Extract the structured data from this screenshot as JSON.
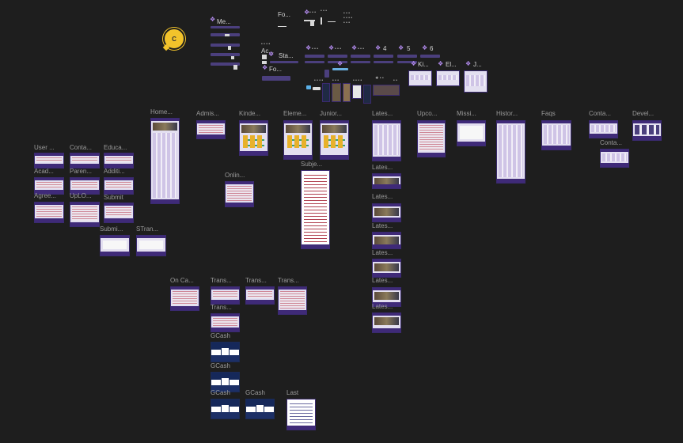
{
  "presence": {
    "initial": "C"
  },
  "components": {
    "menu_label": "Me...",
    "fo_label": "Fo...",
    "sta_label": "Sta...",
    "fo2_label": "Fo...",
    "num_4": "4",
    "num_5": "5",
    "num_6": "6",
    "el_label": "El...",
    "j_label": "J...",
    "ki_label": "Ki...",
    "ac_label": "Ac..."
  },
  "frames": {
    "user": "User ...",
    "contact1": "Conta...",
    "educa": "Educa...",
    "acad": "Acad...",
    "paren": "Paren...",
    "additi": "Additi...",
    "agree": "Agree...",
    "upload": "UpLO...",
    "submit1": "Submit",
    "submi2": "Submi...",
    "stran": "STran...",
    "home": "Home...",
    "admis": "Admis...",
    "kinde": "Kinde...",
    "eleme": "Eleme...",
    "junior": "Junior...",
    "onlin": "Onlin...",
    "subje": "Subje...",
    "lates1": "Lates...",
    "lates2": "Lates...",
    "lates3": "Lates...",
    "lates4": "Lates...",
    "lates5": "Lates...",
    "lates6": "Lates...",
    "lates7": "Lates...",
    "upco": "Upco...",
    "missi": "Missi...",
    "histor": "Histor...",
    "faqs": "Faqs",
    "conta2": "Conta...",
    "conta3": "Conta...",
    "devel": "Devel...",
    "onca": "On Ca...",
    "trans1": "Trans...",
    "trans2": "Trans...",
    "trans3": "Trans...",
    "trans4": "Trans...",
    "gcash1": "GCash",
    "gcash2": "GCash",
    "gcash3": "GCash",
    "gcash4": "GCash",
    "last": "Last"
  }
}
